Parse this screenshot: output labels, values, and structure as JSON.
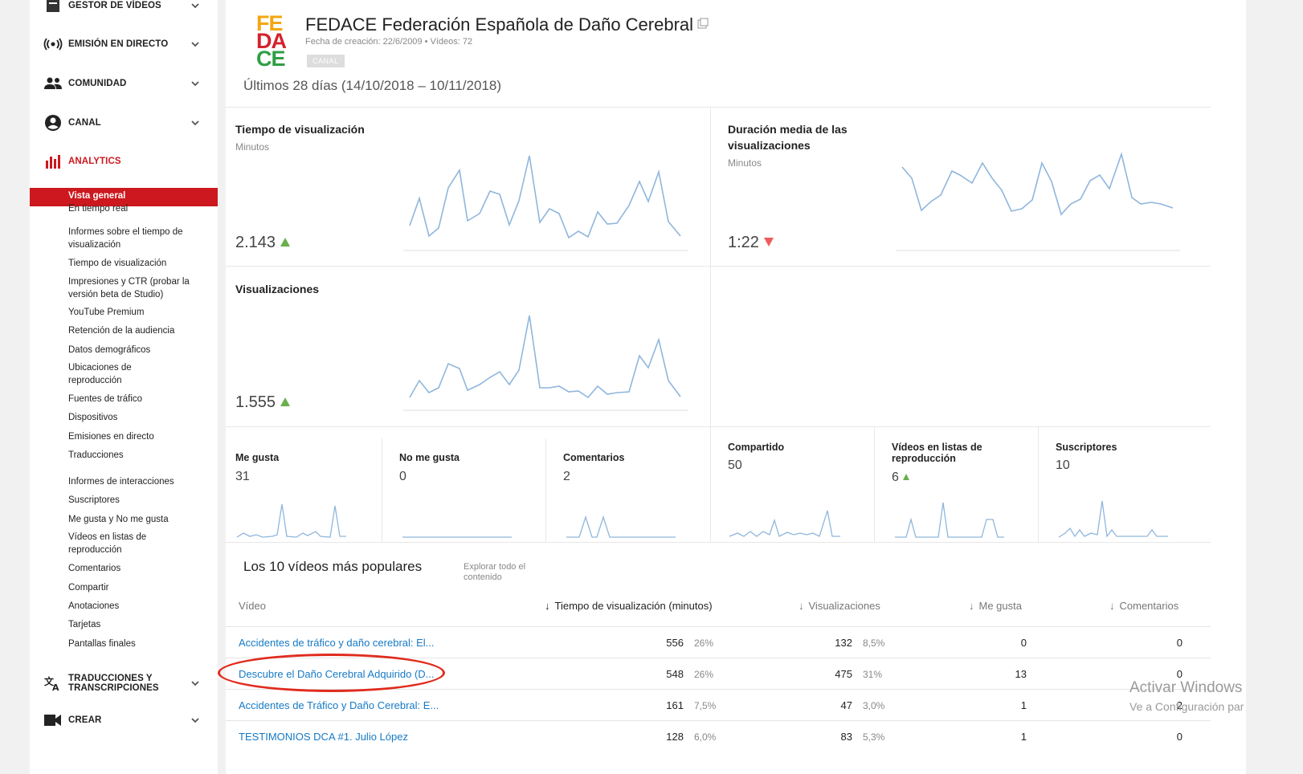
{
  "sidebar": {
    "sections": [
      {
        "label": "GESTOR DE VÍDEOS",
        "icon": "video-manager-icon"
      },
      {
        "label": "EMISIÓN EN DIRECTO",
        "icon": "live-broadcast-icon"
      },
      {
        "label": "COMUNIDAD",
        "icon": "community-icon"
      },
      {
        "label": "CANAL",
        "icon": "channel-icon"
      },
      {
        "label": "ANALYTICS",
        "icon": "analytics-icon"
      },
      {
        "label": "TRADUCCIONES Y TRANSCRIPCIONES",
        "icon": "translate-icon"
      },
      {
        "label": "CREAR",
        "icon": "camera-icon"
      }
    ],
    "analytics_items": [
      "Vista general",
      "En tiempo real",
      "Informes sobre el tiempo de visualización",
      "Tiempo de visualización",
      "Impresiones y CTR (probar la versión beta de Studio)",
      "YouTube Premium",
      "Retención de la audiencia",
      "Datos demográficos",
      "Ubicaciones de reproducción",
      "Fuentes de tráfico",
      "Dispositivos",
      "Emisiones en directo",
      "Traducciones",
      "Informes de interacciones",
      "Suscriptores",
      "Me gusta y No me gusta",
      "Vídeos en listas de reproducción",
      "Comentarios",
      "Compartir",
      "Anotaciones",
      "Tarjetas",
      "Pantallas finales"
    ]
  },
  "channel": {
    "logo_lines": [
      "FE",
      "DA",
      "CE"
    ],
    "name": "FEDACE Federación Española de Daño Cerebral",
    "meta": "Fecha de creación: 22/6/2009  •  Vídeos: 72",
    "badge": "CANAL",
    "range": "Últimos 28 días (14/10/2018 – 10/11/2018)"
  },
  "metrics": {
    "watch_time": {
      "title": "Tiempo de visualización",
      "unit": "Minutos",
      "value": "2.143",
      "trend": "up"
    },
    "avg_duration": {
      "title": "Duración media de las visualizaciones",
      "unit": "Minutos",
      "value": "1:22",
      "trend": "down"
    },
    "views": {
      "title": "Visualizaciones",
      "value": "1.555",
      "trend": "up"
    }
  },
  "small_metrics": [
    {
      "title": "Me gusta",
      "value": "31"
    },
    {
      "title": "No me gusta",
      "value": "0"
    },
    {
      "title": "Comentarios",
      "value": "2"
    },
    {
      "title": "Compartido",
      "value": "50"
    },
    {
      "title": "Vídeos en listas de reproducción",
      "value": "6"
    },
    {
      "title": "Suscriptores",
      "value": "10"
    }
  ],
  "top_videos": {
    "title": "Los 10 vídeos más populares",
    "explore": "Explorar todo el contenido",
    "headers": [
      "Vídeo",
      "Tiempo de visualización (minutos)",
      "Visualizaciones",
      "Me gusta",
      "Comentarios"
    ],
    "rows": [
      {
        "title": "Accidentes de tráfico y daño cerebral: El...",
        "time": "556",
        "time_pct": "26%",
        "views": "132",
        "views_pct": "8,5%",
        "likes": "0",
        "comments": "0"
      },
      {
        "title": "Descubre el Daño Cerebral Adquirido (D...",
        "time": "548",
        "time_pct": "26%",
        "views": "475",
        "views_pct": "31%",
        "likes": "13",
        "comments": "0"
      },
      {
        "title": "Accidentes de Tráfico y Daño Cerebral: E...",
        "time": "161",
        "time_pct": "7,5%",
        "views": "47",
        "views_pct": "3,0%",
        "likes": "1",
        "comments": "2"
      },
      {
        "title": "TESTIMONIOS DCA #1. Julio López",
        "time": "128",
        "time_pct": "6,0%",
        "views": "83",
        "views_pct": "5,3%",
        "likes": "1",
        "comments": "0"
      }
    ]
  },
  "watermark": {
    "line1": "Activar Windows",
    "line2": "Ve a Configuración par"
  },
  "colors": {
    "accent": "#cc181e",
    "link": "#167ac6",
    "spark": "#8fb6dc",
    "up": "#6ab04c",
    "down": "#ee5b5b"
  }
}
